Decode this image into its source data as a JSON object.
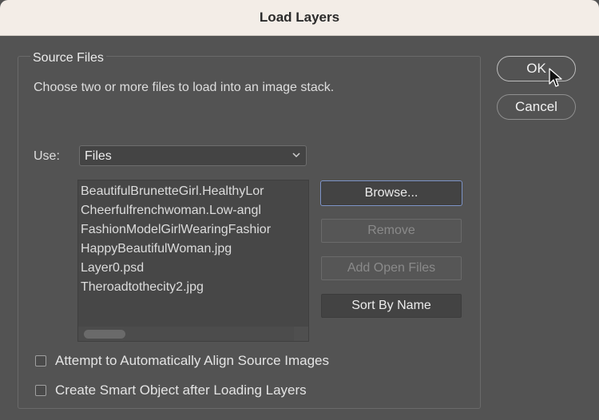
{
  "window": {
    "title": "Load Layers"
  },
  "source_files": {
    "group_label": "Source Files",
    "instructions": "Choose two or more files to load into an image stack.",
    "use_label": "Use:",
    "use_value": "Files",
    "files": [
      "BeautifulBrunetteGirl.HealthyLor",
      "Cheerfulfrenchwoman.Low-angl",
      "FashionModelGirlWearingFashior",
      "HappyBeautifulWoman.jpg",
      "Layer0.psd",
      "Theroadtothecity2.jpg"
    ]
  },
  "buttons": {
    "browse": "Browse...",
    "remove": "Remove",
    "add_open_files": "Add Open Files",
    "sort_by_name": "Sort By Name"
  },
  "dialog_buttons": {
    "ok": "OK",
    "cancel": "Cancel"
  },
  "options": {
    "align": {
      "label": "Attempt to Automatically Align Source Images",
      "checked": false
    },
    "smart_object": {
      "label": "Create Smart Object after Loading Layers",
      "checked": false
    }
  }
}
